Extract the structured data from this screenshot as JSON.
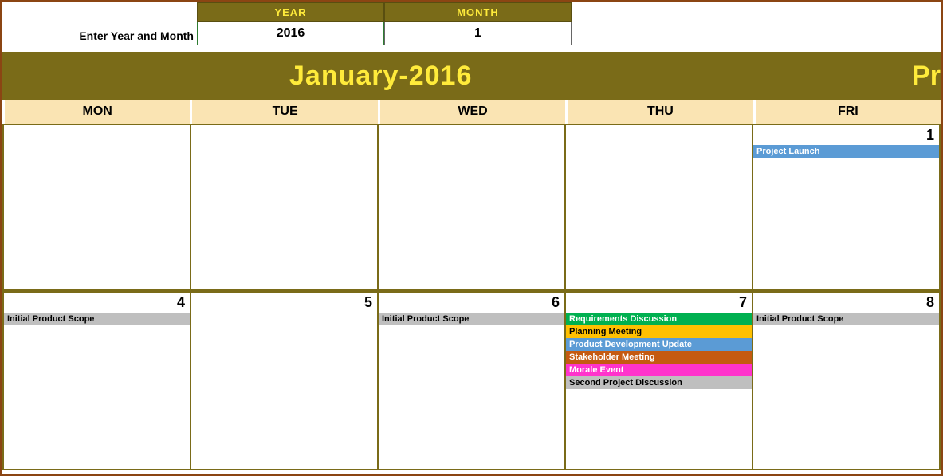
{
  "input": {
    "label": "Enter Year and Month",
    "year_header": "YEAR",
    "month_header": "MONTH",
    "year_value": "2016",
    "month_value": "1"
  },
  "banner": {
    "title": "January-2016",
    "right_partial": "Pr"
  },
  "days": [
    "MON",
    "TUE",
    "WED",
    "THU",
    "FRI"
  ],
  "dates": {
    "r1c5": "1",
    "r2c1": "4",
    "r2c2": "5",
    "r2c3": "6",
    "r2c4": "7",
    "r2c5": "8"
  },
  "events": {
    "fri1_1": "Project Launch",
    "mon4_1": "Initial Product Scope",
    "wed6_1": "Initial Product Scope",
    "thu7_1": "Requirements Discussion",
    "thu7_2": "Planning Meeting",
    "thu7_3": "Product Development Update",
    "thu7_4": "Stakeholder Meeting",
    "thu7_5": "Morale Event",
    "thu7_6": "Second Project Discussion",
    "fri8_1": "Initial Product Scope"
  }
}
